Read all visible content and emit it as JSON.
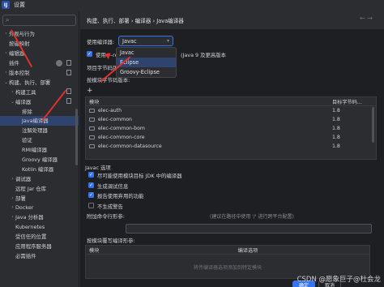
{
  "window": {
    "title": "设置",
    "app_icon": "IJ"
  },
  "sidebar": {
    "search_placeholder": "",
    "items": [
      {
        "label": "外观与行为",
        "indent": 0,
        "chevron": "›"
      },
      {
        "label": "按键映射",
        "indent": 0,
        "chevron": ""
      },
      {
        "label": "编辑器",
        "indent": 0,
        "chevron": "›"
      },
      {
        "label": "插件",
        "indent": 0,
        "chevron": ""
      },
      {
        "label": "版本控制",
        "indent": 0,
        "chevron": "›"
      },
      {
        "label": "构建、执行、部署",
        "indent": 0,
        "chevron": "⌄"
      },
      {
        "label": "构建工具",
        "indent": 1,
        "chevron": "›"
      },
      {
        "label": "编译器",
        "indent": 1,
        "chevron": "⌄"
      },
      {
        "label": "排除",
        "indent": 2,
        "chevron": ""
      },
      {
        "label": "Java编译器",
        "indent": 2,
        "chevron": "",
        "selected": true
      },
      {
        "label": "注解处理器",
        "indent": 2,
        "chevron": ""
      },
      {
        "label": "验证",
        "indent": 2,
        "chevron": ""
      },
      {
        "label": "RMI编译器",
        "indent": 2,
        "chevron": ""
      },
      {
        "label": "Groovy 编译器",
        "indent": 2,
        "chevron": ""
      },
      {
        "label": "Kotlin 编译器",
        "indent": 2,
        "chevron": ""
      },
      {
        "label": "调试器",
        "indent": 1,
        "chevron": "›"
      },
      {
        "label": "远程 Jar 仓库",
        "indent": 1,
        "chevron": ""
      },
      {
        "label": "部署",
        "indent": 1,
        "chevron": "›"
      },
      {
        "label": "Docker",
        "indent": 1,
        "chevron": "›"
      },
      {
        "label": "Java 分析器",
        "indent": 1,
        "chevron": "›"
      },
      {
        "label": "Kubernetes",
        "indent": 1,
        "chevron": ""
      },
      {
        "label": "受信任的位置",
        "indent": 1,
        "chevron": ""
      },
      {
        "label": "应用程序服务器",
        "indent": 1,
        "chevron": ""
      },
      {
        "label": "必需插件",
        "indent": 1,
        "chevron": ""
      }
    ]
  },
  "breadcrumb": "构建、执行、部署 › 编译器 › Java编译器",
  "compiler": {
    "label": "使用编译器:",
    "value": "Javac",
    "options": [
      "Javac",
      "Eclipse",
      "Groovy-Eclipse"
    ],
    "highlighted_option": "Eclipse"
  },
  "release_option": {
    "prefix": "使用 '--re",
    "suffix": "(Java 9 及更高版本",
    "checked": true
  },
  "project_bytecode_label": "项目字节码版",
  "per_module_label": "按模块字节码版本:",
  "module_table": {
    "headers": [
      "模块",
      "目标字节码..."
    ],
    "rows": [
      {
        "module": "elec-auth",
        "version": "1.8"
      },
      {
        "module": "elec-common",
        "version": "1.8"
      },
      {
        "module": "elec-common-bom",
        "version": "1.8"
      },
      {
        "module": "elec-common-core",
        "version": "1.8"
      },
      {
        "module": "elec-common-datasource",
        "version": "1.8"
      }
    ]
  },
  "javac_options": {
    "title": "Javac 选项",
    "checkboxes": [
      {
        "label": "尽可能使用模块目标 JDK 中的编译器",
        "checked": true
      },
      {
        "label": "生成调试信息",
        "checked": true
      },
      {
        "label": "报告使用弃用的功能",
        "checked": true
      },
      {
        "label": "不生成警告",
        "checked": false
      }
    ],
    "extra_params_label": "附加命令行形参:",
    "extra_params_hint": "(建议在路径中使用 '/' 进行跨平台配置)",
    "extra_params_value": ""
  },
  "override_section": {
    "title": "按模块覆写编译形参:",
    "headers": [
      "模块",
      "编译选项"
    ],
    "empty_text": "将传编译器选项添加到特定模块"
  },
  "buttons": {
    "ok": "确定",
    "cancel": "取消"
  },
  "watermark": "CSDN @愿象巨子@杜会龙",
  "colors": {
    "accent": "#3574f0",
    "annotation_arrow": "#e0312b",
    "selection": "#2e436e"
  }
}
